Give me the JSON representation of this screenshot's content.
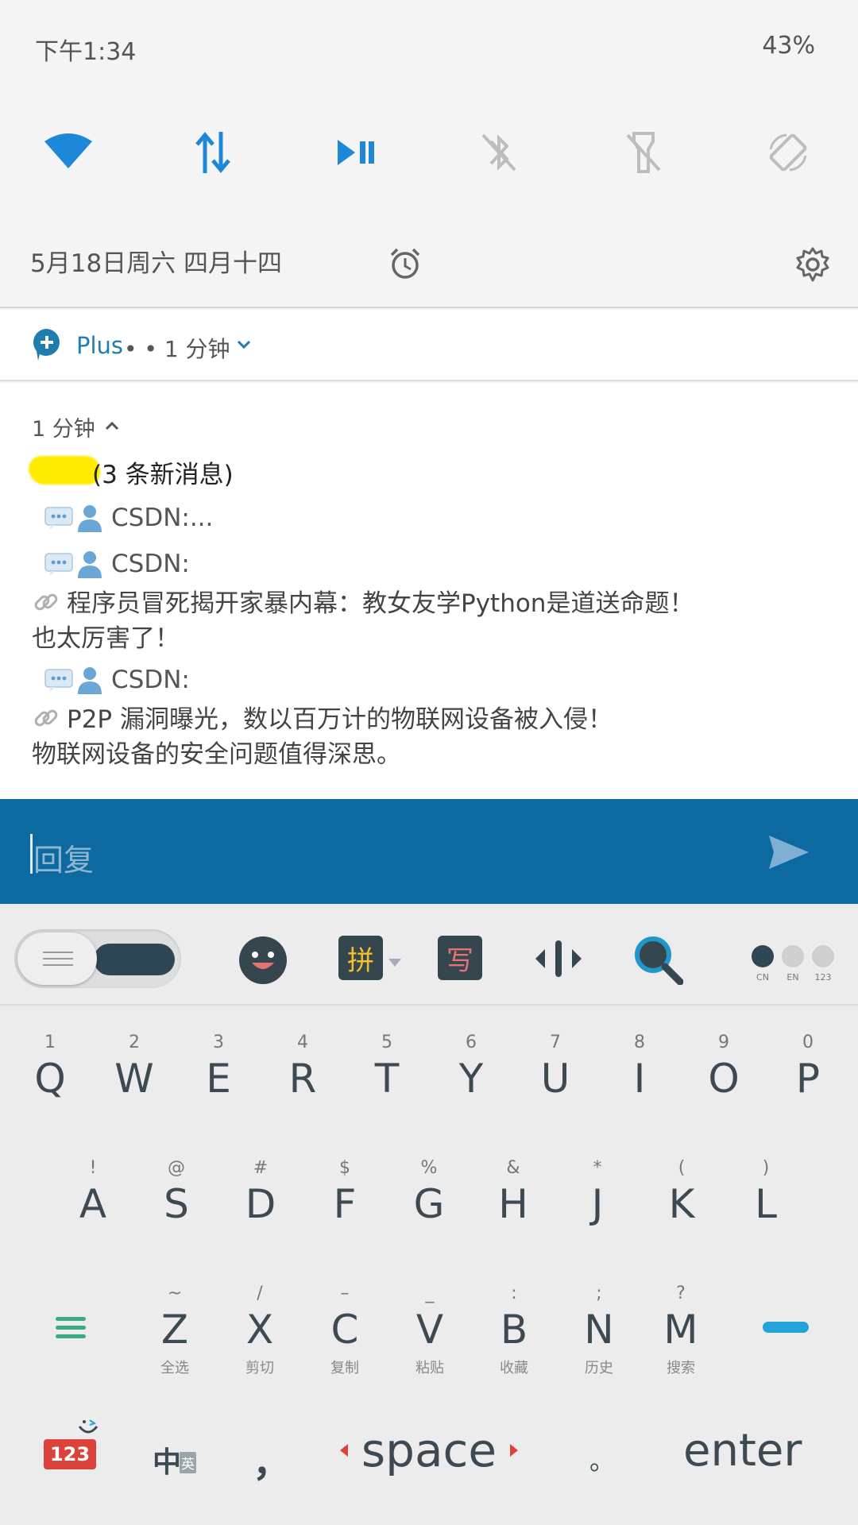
{
  "status": {
    "time": "下午1:34",
    "battery": "43%"
  },
  "quick_settings": {
    "tiles": [
      "wifi-icon",
      "mobile-data-icon",
      "play-pause-icon",
      "bluetooth-off-icon",
      "flashlight-off-icon",
      "auto-rotate-icon"
    ],
    "date": "5月18日周六 四月十四"
  },
  "notification": {
    "app_name": "Plus",
    "app_meta": "• • 1 分钟",
    "time": "1 分钟",
    "title": "(3 条新消息)",
    "messages": [
      {
        "sender": "CSDN:..."
      },
      {
        "sender": "CSDN:",
        "line1": "程序员冒死揭开家暴内幕：教女友学Python是道送命题！",
        "line2": "也太厉害了！"
      },
      {
        "sender": "CSDN:",
        "line1": "P2P 漏洞曝光，数以百万计的物联网设备被入侵！",
        "line2": "物联网设备的安全问题值得深思。"
      }
    ]
  },
  "reply": {
    "placeholder": "回复"
  },
  "keyboard": {
    "toolbar": {
      "pinyin": "拼",
      "handwrite": "写",
      "modes": [
        "CN",
        "EN",
        "123"
      ],
      "active_mode": "CN"
    },
    "row1": [
      {
        "top": "1",
        "main": "Q"
      },
      {
        "top": "2",
        "main": "W"
      },
      {
        "top": "3",
        "main": "E"
      },
      {
        "top": "4",
        "main": "R"
      },
      {
        "top": "5",
        "main": "T"
      },
      {
        "top": "6",
        "main": "Y"
      },
      {
        "top": "7",
        "main": "U"
      },
      {
        "top": "8",
        "main": "I"
      },
      {
        "top": "9",
        "main": "O"
      },
      {
        "top": "0",
        "main": "P"
      }
    ],
    "row2": [
      {
        "top": "!",
        "main": "A"
      },
      {
        "top": "@",
        "main": "S"
      },
      {
        "top": "#",
        "main": "D"
      },
      {
        "top": "$",
        "main": "F"
      },
      {
        "top": "%",
        "main": "G"
      },
      {
        "top": "&",
        "main": "H"
      },
      {
        "top": "*",
        "main": "J"
      },
      {
        "top": "(",
        "main": "K"
      },
      {
        "top": ")",
        "main": "L"
      }
    ],
    "row3": [
      {
        "top": "~",
        "main": "Z",
        "sub": "全选"
      },
      {
        "top": "/",
        "main": "X",
        "sub": "剪切"
      },
      {
        "top": "–",
        "main": "C",
        "sub": "复制"
      },
      {
        "top": "_",
        "main": "V",
        "sub": "粘贴"
      },
      {
        "top": ":",
        "main": "B",
        "sub": "收藏"
      },
      {
        "top": ";",
        "main": "N",
        "sub": "历史"
      },
      {
        "top": "?",
        "main": "M",
        "sub": "搜索"
      }
    ],
    "bottom": {
      "num": "123",
      "lang": "中",
      "lang_sub": "英",
      "comma": "，",
      "space": "space",
      "period": "。",
      "enter": "enter"
    }
  },
  "colors": {
    "accent": "#0d6aa1",
    "tile_blue": "#1e88d8",
    "number_key": "#d9433a",
    "dash_key": "#24a3d8"
  }
}
